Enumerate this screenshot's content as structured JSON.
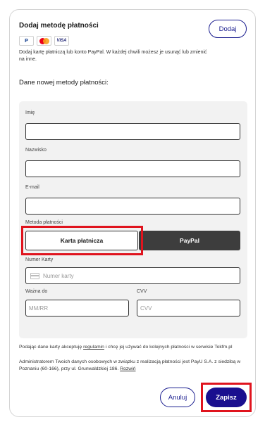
{
  "header": {
    "title": "Dodaj metodę płatności",
    "add_label": "Dodaj",
    "logos": [
      "paypal-logo",
      "mastercard-logo",
      "visa-logo"
    ],
    "paypal_mark": "P",
    "visa_mark": "VISA",
    "intro": "Dodaj kartę płatniczą lub konto PayPal. W każdej chwili możesz je usunąć lub zmienić na inne."
  },
  "form": {
    "section_title": "Dane nowej metody płatności:",
    "first_name_label": "Imię",
    "first_name_value": "",
    "last_name_label": "Nazwisko",
    "last_name_value": "",
    "email_label": "E-mail",
    "email_value": "",
    "method_label": "Metoda płatności",
    "method_card": "Karta płatnicza",
    "method_paypal": "PayPal",
    "card_number_label": "Numer Karty",
    "card_number_placeholder": "Numer karty",
    "expiry_label": "Ważna do",
    "expiry_placeholder": "MM/RR",
    "cvv_label": "CVV",
    "cvv_placeholder": "CVV"
  },
  "legal": {
    "consent_prefix": "Podając dane karty akceptuję",
    "regulations_link": "regulamin",
    "consent_suffix": "i chcę jej używać do kolejnych płatności w serwisie Tokfm.pl",
    "admin_text": "Administratorem Twoich danych osobowych w związku z realizacją płatności jest PayU S.A. z siedzibą w Poznaniu (60-166), przy ul. Grunwaldzkiej 186.",
    "expand_link": "Rozwiń"
  },
  "actions": {
    "cancel_label": "Anuluj",
    "save_label": "Zapisz"
  },
  "colors": {
    "primary": "#1a0f8f",
    "highlight": "#e0141e",
    "paypal_bg": "#3d3d3d"
  }
}
